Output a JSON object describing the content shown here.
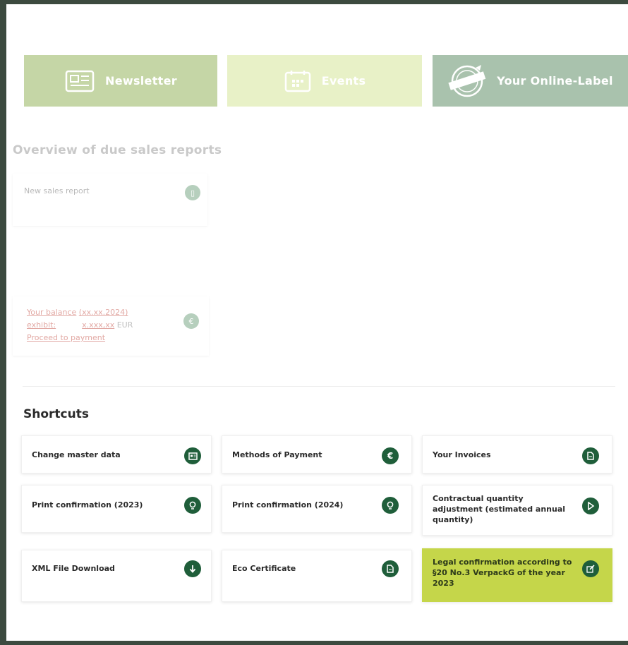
{
  "tiles": {
    "newsletter": "Newsletter",
    "events": "Events",
    "online_label": "Your Online-Label"
  },
  "overview": {
    "title": "Overview of due sales reports",
    "new_report": "New sales report"
  },
  "balance": {
    "line1_label": "Your balance",
    "line1_date": "(xx.xx.2024)",
    "line2_label": "exhibit:",
    "line2_value": "x.xxx,xx",
    "line2_unit": "EUR",
    "proceed": "Proceed to payment"
  },
  "shortcuts": {
    "title": "Shortcuts",
    "items": [
      {
        "label": "Change master data",
        "icon": "id-card-icon"
      },
      {
        "label": "Methods of Payment",
        "icon": "euro-icon"
      },
      {
        "label": "Your Invoices",
        "icon": "document-icon"
      },
      {
        "label": "Print confirmation (2023)",
        "icon": "bulb-icon"
      },
      {
        "label": "Print confirmation (2024)",
        "icon": "bulb-icon"
      },
      {
        "label": "Contractual quantity adjustment (estimated annual quantity)",
        "icon": "play-icon"
      },
      {
        "label": "XML File Download",
        "icon": "download-icon"
      },
      {
        "label": "Eco Certificate",
        "icon": "document-icon"
      },
      {
        "label": "Legal confirmation according to §20 No.3 VerpackG of the year 2023",
        "icon": "edit-icon"
      }
    ]
  },
  "colors": {
    "frame": "#3c4a3f",
    "tile_newsletter": "#c5d6a6",
    "tile_events": "#e8f1c7",
    "tile_label": "#a9c2ad",
    "icon_green": "#1f5e3a",
    "highlight": "#c5d64a"
  }
}
